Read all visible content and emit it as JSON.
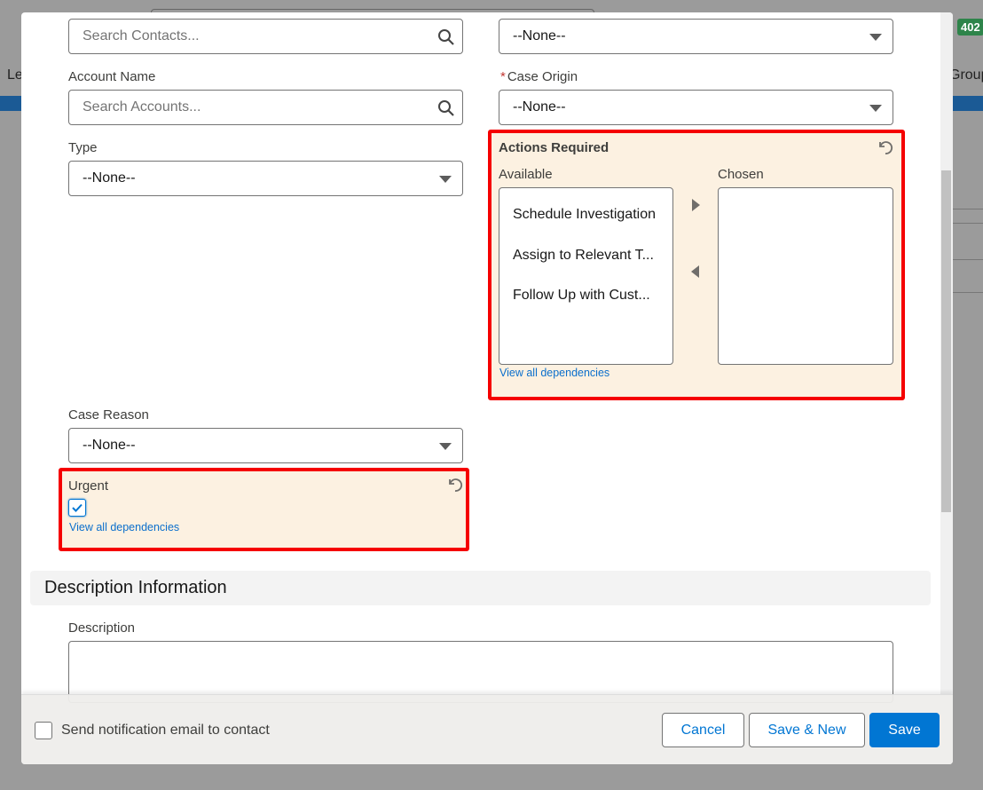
{
  "background": {
    "left_text": "Le",
    "right_text": "Group",
    "badge": "402"
  },
  "form": {
    "contact_search": {
      "placeholder": "Search Contacts..."
    },
    "top_right_select": {
      "value": "--None--"
    },
    "account_name": {
      "label": "Account Name",
      "placeholder": "Search Accounts..."
    },
    "case_origin": {
      "label": "Case Origin",
      "required_mark": "*",
      "value": "--None--"
    },
    "type": {
      "label": "Type",
      "value": "--None--"
    },
    "actions_required": {
      "title": "Actions Required",
      "available_label": "Available",
      "chosen_label": "Chosen",
      "available_options": [
        "Schedule Investigation",
        "Assign to Relevant T...",
        "Follow Up with Cust..."
      ],
      "chosen_options": [],
      "dependencies_link": "View all dependencies"
    },
    "case_reason": {
      "label": "Case Reason",
      "value": "--None--"
    },
    "urgent": {
      "label": "Urgent",
      "checked": true,
      "dependencies_link": "View all dependencies"
    },
    "description_section": {
      "title": "Description Information"
    },
    "description": {
      "label": "Description",
      "value": ""
    }
  },
  "footer": {
    "notify_label": "Send notification email to contact",
    "notify_checked": false,
    "cancel": "Cancel",
    "save_new": "Save & New",
    "save": "Save"
  },
  "colors": {
    "brand": "#0176d3",
    "highlight_border": "#f50000",
    "highlight_bg": "#fcf1e1",
    "badge": "#2e844a"
  }
}
